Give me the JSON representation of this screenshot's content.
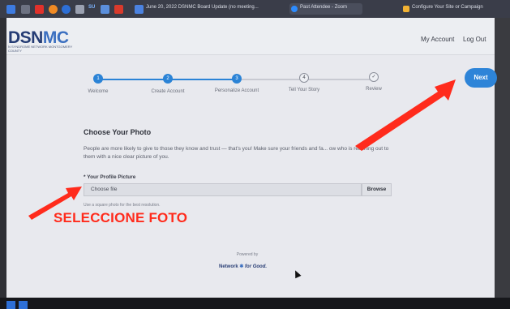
{
  "taskbar": {
    "tab_title": "June 20, 2022 DSNMC Board Update (no meeting...",
    "zoom_tab": "Past Attendee - Zoom",
    "right_tab": "Configure Your Site or Campaign",
    "icon_su": "SU"
  },
  "header": {
    "logo_main": "DSN",
    "logo_accent": "MC",
    "logo_sub": "N SYNDROME NETWORK MONTGOMERY COUNTY",
    "nav": [
      "My Account",
      "Log Out"
    ]
  },
  "stepper": {
    "steps": [
      {
        "num": "1",
        "label": "Welcome",
        "state": "done"
      },
      {
        "num": "2",
        "label": "Create Account",
        "state": "done"
      },
      {
        "num": "3",
        "label": "Personalize Account",
        "state": "done"
      },
      {
        "num": "4",
        "label": "Tell Your Story",
        "state": "todo"
      },
      {
        "num": "✓",
        "label": "Review",
        "state": "todo"
      }
    ],
    "next_label": "Next"
  },
  "form": {
    "title": "Choose Your Photo",
    "description": "People are more likely to give to those they know and trust — that's you! Make sure your friends and fa... ow who is reaching out to them with a nice clear picture of you.",
    "field_label": "* Your Profile Picture",
    "file_placeholder": "Choose file",
    "browse_label": "Browse",
    "hint": "Use a square photo for the best resolution."
  },
  "footer": {
    "powered_by": "Powered by",
    "brand_network": "Network",
    "brand_for_good": "for Good."
  },
  "annotation": {
    "text": "SELECCIONE FOTO",
    "color": "#ff2b1c"
  },
  "colors": {
    "accent": "#2d84d8",
    "logo_dark": "#253c74"
  }
}
